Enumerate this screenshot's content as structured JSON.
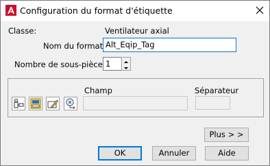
{
  "window": {
    "title": "Configuration du format d'étiquette",
    "app_icon": "autocad-logo-icon",
    "close_icon": "close-icon"
  },
  "form": {
    "class_label": "Classe:",
    "class_value": "Ventilateur axial",
    "format_name_label": "Nom du format:",
    "format_name_value": "Alt_Eqip_Tag",
    "subparts_label": "Nombre de sous-pièces:",
    "subparts_value": "1"
  },
  "group": {
    "field_label": "Champ",
    "field_value": "",
    "separator_label": "Séparateur",
    "separator_value": "",
    "tools": [
      "insert-field-icon",
      "edit-text-icon",
      "edit-pencil-icon",
      "expression-icon"
    ]
  },
  "buttons": {
    "more": "Plus > >",
    "ok": "OK",
    "cancel": "Annuler",
    "help": "Aide"
  },
  "colors": {
    "accent": "#0078d7",
    "dialog_bg": "#f0f0f0",
    "brand_red": "#c8102e"
  }
}
